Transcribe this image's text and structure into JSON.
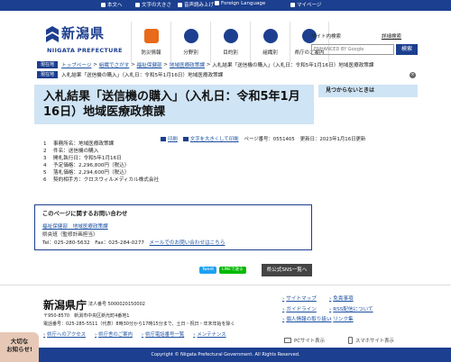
{
  "topbar": {
    "home": "本文へ",
    "fontsize": "文字の大きさ",
    "readaloud": "音声読み上げ",
    "foreign": "Foreign Language",
    "account": "マイページ"
  },
  "logo": {
    "ja": "新潟県",
    "en": "NIIGATA PREFECTURE"
  },
  "nav": [
    {
      "label": "防災情報"
    },
    {
      "label": "分野別"
    },
    {
      "label": "目的別"
    },
    {
      "label": "組織別"
    },
    {
      "label": "県庁のご案内"
    },
    {
      "label": "閲覧補助"
    }
  ],
  "search": {
    "label": "サイト内検索",
    "advanced": "詳細検索",
    "placeholder": "ENHANCED BY Google",
    "button": "検索"
  },
  "breadcrumb": {
    "tag": "現在地",
    "items": [
      "トップページ",
      "組織でさがす",
      "福祉保健部",
      "地域医療政策課",
      "入札結果「送信機の購入」（入札日：令和5年1月16日）地域医療政策課"
    ],
    "row2": "入札結果「送信機の購入」（入札日：令和5年1月16日）地域医療政策課"
  },
  "page": {
    "title": "入札結果「送信機の購入」（入札日：令和5年1月16日）地域医療政策課",
    "print": "印刷",
    "fontbig": "文字を大きくして印刷",
    "page_no": "ページ番号：0551405",
    "updated": "更新日：2023年1月16日更新"
  },
  "items": [
    {
      "n": "1",
      "text": "事務所名：地域医療政策課"
    },
    {
      "n": "2",
      "text": "件名：送信機の購入"
    },
    {
      "n": "3",
      "text": "開札執行日：令和5年1月16日"
    },
    {
      "n": "4",
      "text": "予定価格：2,296,800円（税込）"
    },
    {
      "n": "5",
      "text": "落札価格：2,294,600円（税込）"
    },
    {
      "n": "6",
      "text": "契約相手方：クロスウィルメディカル株式会社"
    }
  ],
  "contact": {
    "heading": "このページに関するお問い合わせ",
    "dept": "福祉保健部　地域医療政策課",
    "section": "県央班（監修計画担当）",
    "tel": "Tel：025-280-5632　Fax：025-284-0277",
    "mail": "メールでのお問い合わせはこちら"
  },
  "share": {
    "tweet": "Tweet",
    "line": "LINEで送る",
    "sns": "県公式SNS一覧へ"
  },
  "sidebar": {
    "heading": "見つからないときは"
  },
  "footer": {
    "name": "新潟県庁",
    "corp": "法人番号 5000020150002",
    "addr": "〒950-8570　新潟市中央区新光町4番地1",
    "tel": "電話番号：025-285-5511（代表）8時30分から17時15分まで、土日・祝日・年末年始を除く",
    "links": [
      "県庁へのアクセス",
      "県庁舎のご案内",
      "県庁電話番号一覧",
      "メンテナンス"
    ],
    "right": [
      [
        "サイトマップ",
        "免責事項"
      ],
      [
        "ガイドライン",
        "RSS配信について"
      ],
      [
        "個人情報の取り扱い",
        "リンク集"
      ]
    ],
    "view_pc": "PCサイト表示",
    "view_sp": "スマホサイト表示",
    "copyright": "Copyright © Niigata Prefectural Government. All Rights Reserved."
  },
  "notice": {
    "line1": "大切な",
    "line2": "お知らせ!"
  },
  "colors": {
    "brand": "#1c3f8f",
    "title_bg": "#cfe4f4",
    "accent": "#e86a1a"
  }
}
